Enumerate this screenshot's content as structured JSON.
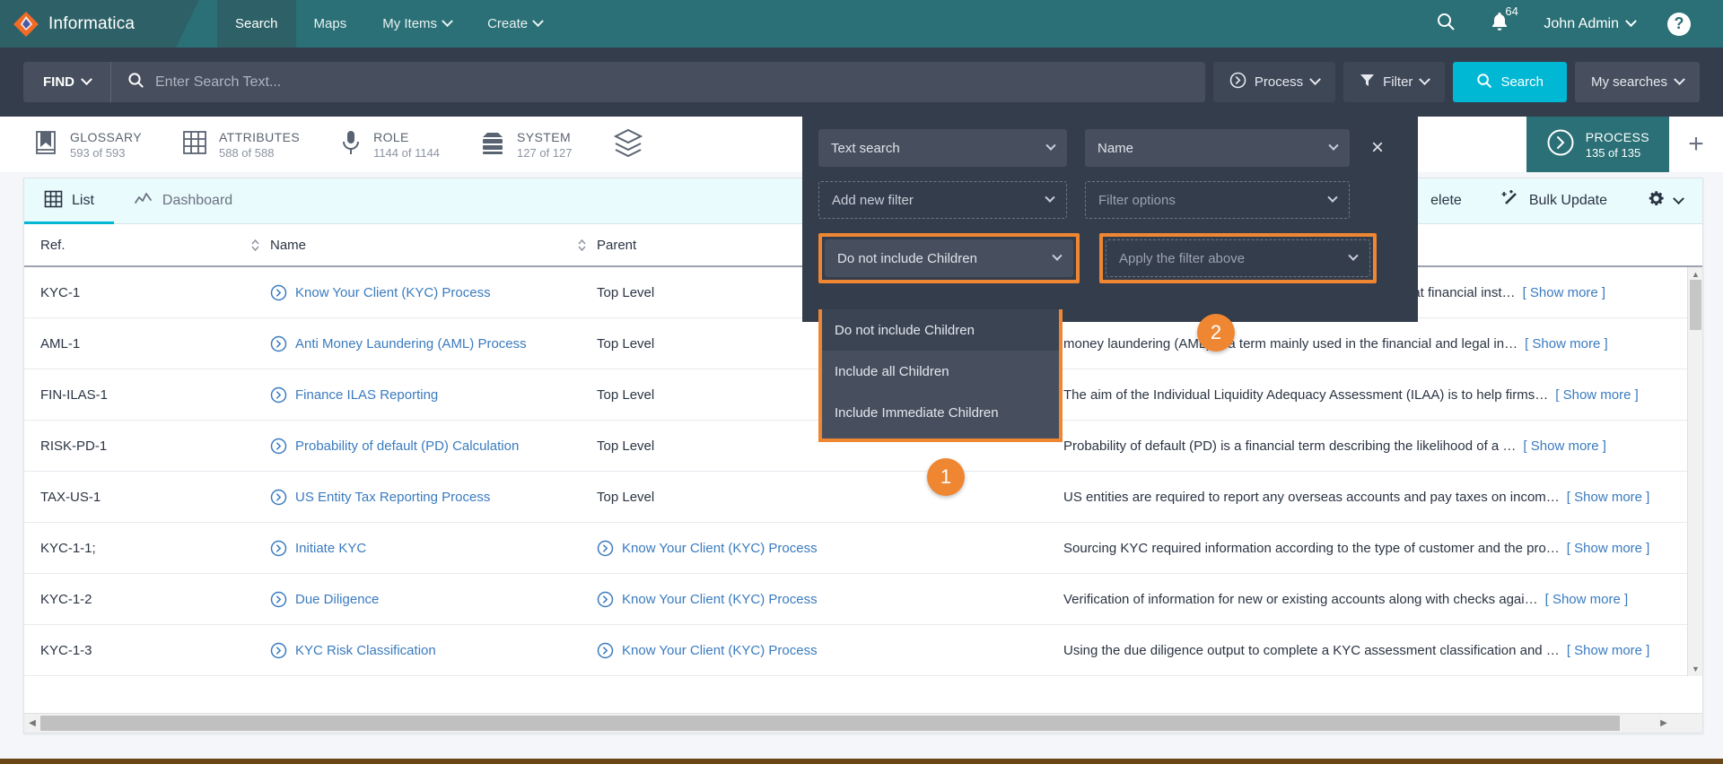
{
  "topnav": {
    "brand": "Informatica",
    "items": [
      {
        "label": "Search",
        "active": true,
        "caret": false
      },
      {
        "label": "Maps",
        "active": false,
        "caret": false
      },
      {
        "label": "My Items",
        "active": false,
        "caret": true
      },
      {
        "label": "Create",
        "active": false,
        "caret": true
      }
    ],
    "search_icon": "search-icon",
    "notifications_icon": "bell-icon",
    "notifications_count": "64",
    "user": "John Admin",
    "help_label": "?"
  },
  "searchbar": {
    "find_label": "FIND",
    "placeholder": "Enter Search Text...",
    "value": "",
    "process_label": "Process",
    "filter_label": "Filter",
    "search_label": "Search",
    "my_searches_label": "My searches"
  },
  "facets": [
    {
      "name": "GLOSSARY",
      "count": "593 of 593",
      "icon": "book-icon",
      "active": false
    },
    {
      "name": "ATTRIBUTES",
      "count": "588 of 588",
      "icon": "grid-icon",
      "active": false
    },
    {
      "name": "ROLE",
      "count": "1144 of 1144",
      "icon": "microphone-icon",
      "active": false
    },
    {
      "name": "SYSTEM",
      "count": "127 of 127",
      "icon": "server-icon",
      "active": false
    },
    {
      "name": "PROCESS",
      "count": "135 of 135",
      "icon": "process-arrow-icon",
      "active": true
    }
  ],
  "facet_stack_icon": "layers-icon",
  "facet_add_label": "+",
  "toolbar": {
    "tabs": [
      {
        "label": "List",
        "icon": "table-grid-icon",
        "active": true
      },
      {
        "label": "Dashboard",
        "icon": "chart-line-icon",
        "active": false
      }
    ],
    "delete_label": "elete",
    "bulk_update_label": "Bulk Update",
    "bulk_update_icon": "magic-wand-icon",
    "settings_icon": "gear-icon"
  },
  "filter_panel": {
    "type_select": "Text search",
    "field_select": "Name",
    "close_label": "×",
    "add_filter_select": "Add new filter",
    "filter_options_select": "Filter options",
    "children_select": "Do not include Children",
    "apply_select": "Apply the filter above",
    "children_options": [
      {
        "label": "Do not include Children",
        "selected": true
      },
      {
        "label": "Include all Children",
        "selected": false
      },
      {
        "label": "Include Immediate Children",
        "selected": false
      }
    ]
  },
  "callouts": [
    {
      "number": "1"
    },
    {
      "number": "2"
    }
  ],
  "table": {
    "columns": [
      {
        "label": "Ref.",
        "sortable": true
      },
      {
        "label": "Name",
        "sortable": true
      },
      {
        "label": "Parent",
        "sortable": false
      },
      {
        "label": "",
        "sortable": false
      }
    ],
    "show_more_label": "[ Show more ]",
    "rows": [
      {
        "ref": "KYC-1",
        "name": "Know Your Client (KYC) Process",
        "parent": "Top Level",
        "parent_link": false,
        "desc": "w Your Customer (KYC) refers to due diligence activities that financial inst…"
      },
      {
        "ref": "AML-1",
        "name": "Anti Money Laundering (AML) Process",
        "parent": "Top Level",
        "parent_link": false,
        "desc": "money laundering (AML) is a term mainly used in the financial and legal in…"
      },
      {
        "ref": "FIN-ILAS-1",
        "name": "Finance ILAS Reporting",
        "parent": "Top Level",
        "parent_link": false,
        "desc": "The aim of the Individual Liquidity Adequacy Assessment (ILAA) is to help firms…"
      },
      {
        "ref": "RISK-PD-1",
        "name": "Probability of default (PD) Calculation",
        "parent": "Top Level",
        "parent_link": false,
        "desc": "Probability of default (PD) is a financial term describing the likelihood of a …"
      },
      {
        "ref": "TAX-US-1",
        "name": "US Entity Tax Reporting Process",
        "parent": "Top Level",
        "parent_link": false,
        "desc": "US entities are required to report any overseas accounts and pay taxes on incom…"
      },
      {
        "ref": "KYC-1-1;",
        "name": "Initiate KYC",
        "parent": "Know Your Client (KYC) Process",
        "parent_link": true,
        "desc": "Sourcing KYC required information according to the type of customer and the pro…"
      },
      {
        "ref": "KYC-1-2",
        "name": "Due Diligence",
        "parent": "Know Your Client (KYC) Process",
        "parent_link": true,
        "desc": "Verification of information for new or existing accounts along with checks agai…"
      },
      {
        "ref": "KYC-1-3",
        "name": "KYC Risk Classification",
        "parent": "Know Your Client (KYC) Process",
        "parent_link": true,
        "desc": "Using the due diligence output to complete a KYC assessment classification and …"
      }
    ]
  },
  "colors": {
    "brand_teal": "#2a7076",
    "dark_slate": "#343d4c",
    "accent_cyan": "#00b7d4",
    "highlight_orange": "#ef8632",
    "link_blue": "#3a7bbf"
  }
}
